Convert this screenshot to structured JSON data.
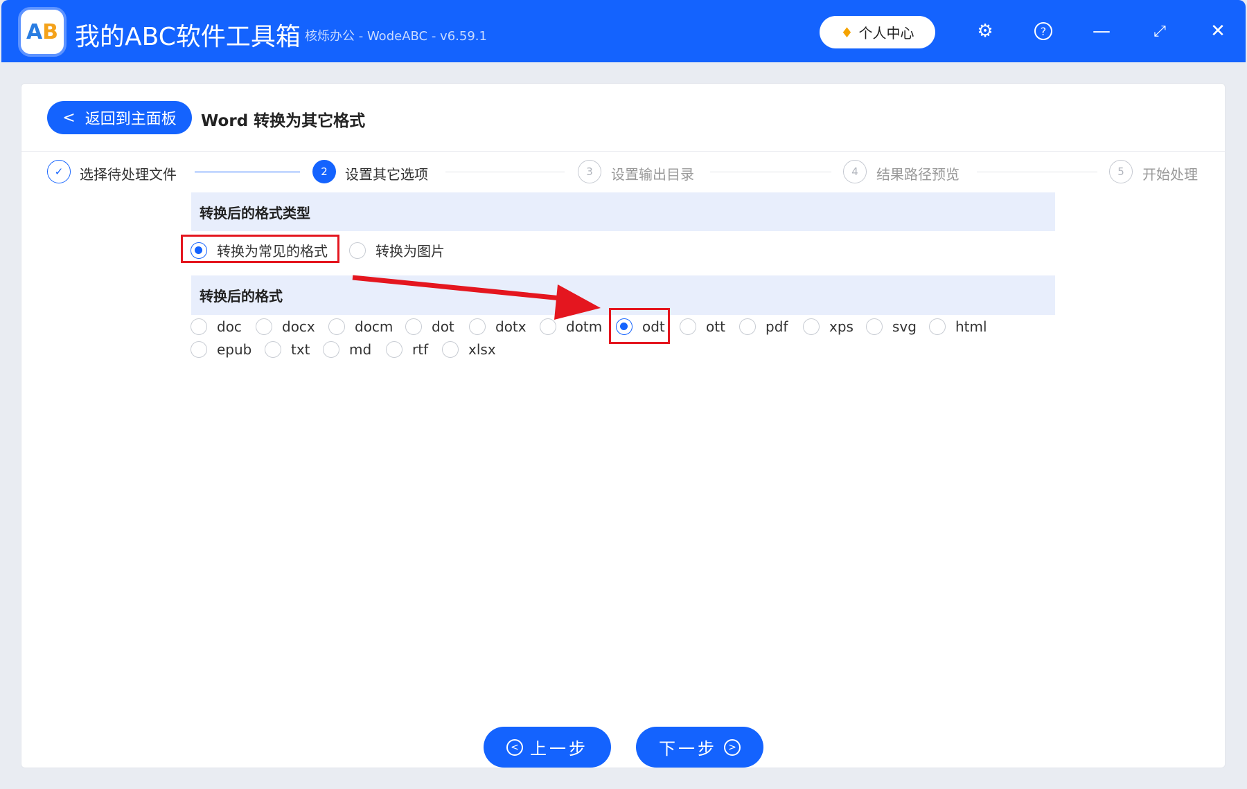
{
  "app": {
    "title": "我的ABC软件工具箱",
    "subtitle": "核烁办公 - WodeABC - v6.59.1",
    "logo_text": "AB",
    "user_center": "个人中心"
  },
  "header": {
    "back_label": "返回到主面板",
    "page_title": "Word 转换为其它格式"
  },
  "steps": [
    {
      "num": "✓",
      "label": "选择待处理文件"
    },
    {
      "num": "2",
      "label": "设置其它选项"
    },
    {
      "num": "3",
      "label": "设置输出目录"
    },
    {
      "num": "4",
      "label": "结果路径预览"
    },
    {
      "num": "5",
      "label": "开始处理"
    }
  ],
  "section1": {
    "title": "转换后的格式类型",
    "options": [
      {
        "label": "转换为常见的格式",
        "selected": true
      },
      {
        "label": "转换为图片",
        "selected": false
      }
    ]
  },
  "section2": {
    "title": "转换后的格式",
    "options": [
      "doc",
      "docx",
      "docm",
      "dot",
      "dotx",
      "dotm",
      "odt",
      "ott",
      "pdf",
      "xps",
      "svg",
      "html",
      "epub",
      "txt",
      "md",
      "rtf",
      "xlsx"
    ],
    "selected": "odt"
  },
  "footer": {
    "prev_label": "上一步",
    "next_label": "下一步"
  },
  "colors": {
    "accent": "#1463fe",
    "highlight": "#e4161f"
  }
}
